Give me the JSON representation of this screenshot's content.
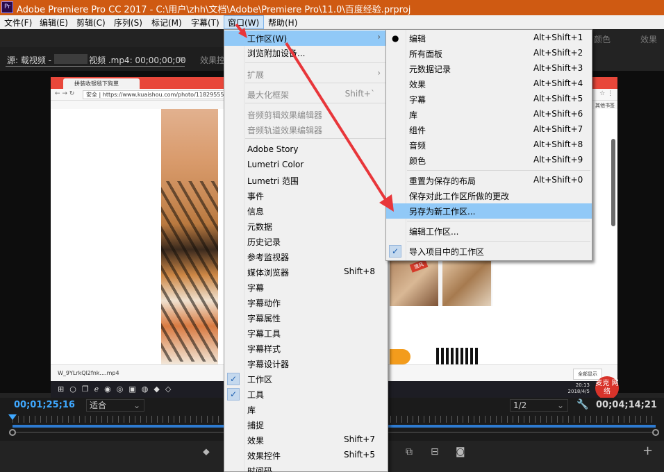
{
  "titlebar": {
    "icon_text": "Pr",
    "title": "Adobe Premiere Pro CC 2017 - C:\\用户\\zhh\\文档\\Adobe\\Premiere Pro\\11.0\\百度经验.prproj"
  },
  "menubar": {
    "items": [
      "文件(F)",
      "编辑(E)",
      "剪辑(C)",
      "序列(S)",
      "标记(M)",
      "字幕(T)",
      "窗口(W)",
      "帮助(H)"
    ]
  },
  "right_strip": {
    "item1": "颜色",
    "item2": "效果"
  },
  "source_panel": {
    "tab_prefix": "源: 载视频 -",
    "tab_suffix": "视频 .mp4: 00;00;00;00",
    "effects_tab": "效果控"
  },
  "video": {
    "browser_tab": "拼装收银毯下狗崽",
    "url": "安全 | https://www.kuaishou.com/photo/118295552/5",
    "bookmarks_right": "其他书签",
    "collage_badge": "速风",
    "download_item": "W_9YLrkQl2fnk....mp4",
    "download_showall": "全部显示",
    "clock_time": "20:13",
    "clock_date": "2018/4/5",
    "watermark": "麦克 网络"
  },
  "timecode": {
    "in": "00;01;25;16",
    "fit": "适合",
    "page": "1/2",
    "out": "00;04;14;21"
  },
  "menu_window": {
    "items": [
      {
        "label": "工作区(W)",
        "shortcut": "",
        "submenu": true,
        "highlighted": true
      },
      {
        "label": "浏览附加设备...",
        "shortcut": ""
      },
      {
        "label": "扩展",
        "shortcut": "",
        "submenu": true,
        "disabled": true
      },
      {
        "label": "最大化框架",
        "shortcut": "Shift+`",
        "disabled": true
      },
      {
        "label": "音频剪辑效果编辑器",
        "shortcut": "",
        "disabled": true
      },
      {
        "label": "音频轨道效果编辑器",
        "shortcut": "",
        "disabled": true
      },
      {
        "label": "Adobe Story",
        "shortcut": ""
      },
      {
        "label": "Lumetri Color",
        "shortcut": ""
      },
      {
        "label": "Lumetri 范围",
        "shortcut": ""
      },
      {
        "label": "事件",
        "shortcut": ""
      },
      {
        "label": "信息",
        "shortcut": ""
      },
      {
        "label": "元数据",
        "shortcut": ""
      },
      {
        "label": "历史记录",
        "shortcut": ""
      },
      {
        "label": "参考监视器",
        "shortcut": ""
      },
      {
        "label": "媒体浏览器",
        "shortcut": "Shift+8"
      },
      {
        "label": "字幕",
        "shortcut": ""
      },
      {
        "label": "字幕动作",
        "shortcut": ""
      },
      {
        "label": "字幕属性",
        "shortcut": ""
      },
      {
        "label": "字幕工具",
        "shortcut": ""
      },
      {
        "label": "字幕样式",
        "shortcut": ""
      },
      {
        "label": "字幕设计器",
        "shortcut": ""
      },
      {
        "label": "工作区",
        "shortcut": "",
        "checked": true
      },
      {
        "label": "工具",
        "shortcut": "",
        "checked": true
      },
      {
        "label": "库",
        "shortcut": ""
      },
      {
        "label": "捕捉",
        "shortcut": ""
      },
      {
        "label": "效果",
        "shortcut": "Shift+7"
      },
      {
        "label": "效果控件",
        "shortcut": "Shift+5"
      },
      {
        "label": "时间码",
        "shortcut": ""
      }
    ]
  },
  "menu_workspace": {
    "items": [
      {
        "label": "编辑",
        "shortcut": "Alt+Shift+1",
        "selected": true
      },
      {
        "label": "所有面板",
        "shortcut": "Alt+Shift+2"
      },
      {
        "label": "元数据记录",
        "shortcut": "Alt+Shift+3"
      },
      {
        "label": "效果",
        "shortcut": "Alt+Shift+4"
      },
      {
        "label": "字幕",
        "shortcut": "Alt+Shift+5"
      },
      {
        "label": "库",
        "shortcut": "Alt+Shift+6"
      },
      {
        "label": "组件",
        "shortcut": "Alt+Shift+7"
      },
      {
        "label": "音频",
        "shortcut": "Alt+Shift+8"
      },
      {
        "label": "颜色",
        "shortcut": "Alt+Shift+9"
      },
      {
        "label": "重置为保存的布局",
        "shortcut": "Alt+Shift+0"
      },
      {
        "label": "保存对此工作区所做的更改",
        "shortcut": ""
      },
      {
        "label": "另存为新工作区...",
        "shortcut": "",
        "highlighted": true
      },
      {
        "label": "编辑工作区...",
        "shortcut": ""
      },
      {
        "label": "导入项目中的工作区",
        "shortcut": "",
        "checked": true
      }
    ]
  },
  "colors": {
    "titlebar": "#cf5a12",
    "highlight": "#91c9f7",
    "timecode_blue": "#3fa8ff",
    "annotation_arrow": "#e8363a"
  }
}
